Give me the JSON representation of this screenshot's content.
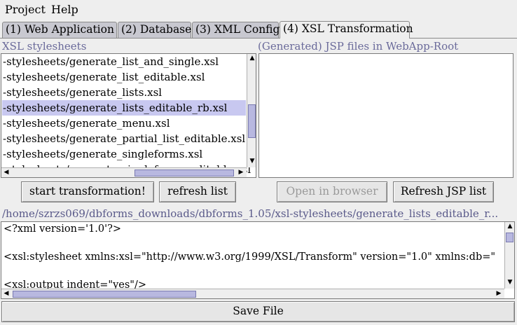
{
  "menubar": {
    "items": [
      {
        "label": "Project"
      },
      {
        "label": "Help"
      }
    ]
  },
  "tabs": [
    {
      "label": "(1) Web Application",
      "selected": false
    },
    {
      "label": "(2) Database",
      "selected": false
    },
    {
      "label": "(3) XML Config",
      "selected": false
    },
    {
      "label": "(4) XSL Transformation",
      "selected": true
    }
  ],
  "stylesheets": {
    "title": "XSL stylesheets",
    "items": [
      "-stylesheets/generate_list_and_single.xsl",
      "-stylesheets/generate_list_editable.xsl",
      "-stylesheets/generate_lists.xsl",
      "-stylesheets/generate_lists_editable_rb.xsl",
      "-stylesheets/generate_menu.xsl",
      "-stylesheets/generate_partial_list_editable.xsl",
      "-stylesheets/generate_singleforms.xsl",
      "-stylesheets/generate_singleforms_editable.xsl"
    ],
    "selected_index": 3
  },
  "jsp_files": {
    "title": "(Generated) JSP files in WebApp-Root",
    "items": []
  },
  "buttons": {
    "start_transformation": "start transformation!",
    "refresh_list": "refresh list",
    "open_in_browser": "Open in browser",
    "refresh_jsp_list": "Refresh JSP list",
    "save_file": "Save File"
  },
  "editor": {
    "file_path": "/home/szrzs069/dbforms_downloads/dbforms_1.05/xsl-stylesheets/generate_lists_editable_r...",
    "lines": [
      "<?xml version='1.0'?>",
      "",
      "<xsl:stylesheet xmlns:xsl=\"http://www.w3.org/1999/XSL/Transform\" version=\"1.0\" xmlns:db=\"",
      "",
      "<xsl:output indent=\"yes\"/>"
    ]
  },
  "colors": {
    "background": "#eeeeee",
    "selection": "#c8c8f0",
    "label_accent": "#6a6a9a",
    "scroll_thumb": "#b8b8e0"
  }
}
